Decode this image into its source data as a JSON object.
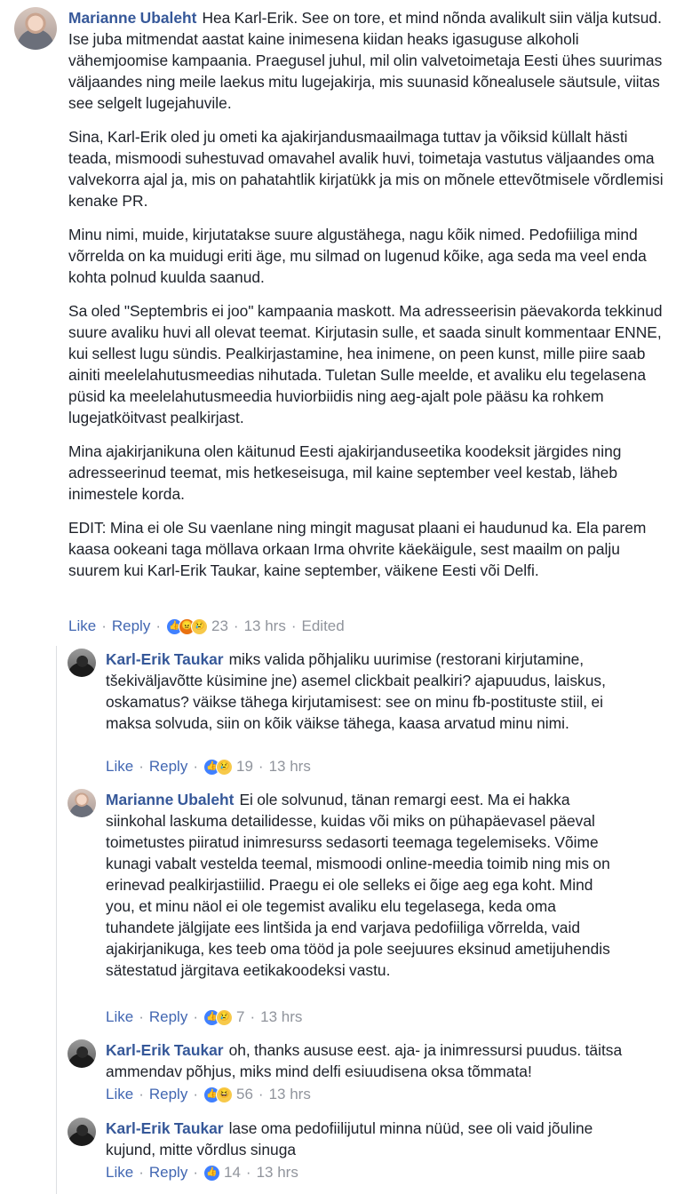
{
  "comments": [
    {
      "author": "Marianne Ubaleht",
      "paragraphs": [
        "Hea Karl-Erik. See on tore, et mind nõnda avalikult siin välja kutsud. Ise juba mitmendat aastat kaine inimesena kiidan heaks igasuguse alkoholi vähemjoomise kampaania. Praegusel juhul, mil olin valvetoimetaja Eesti ühes suurimas väljaandes ning meile laekus mitu lugejakirja, mis suunasid kõnealusele säutsule, viitas see selgelt lugejahuvile.",
        "Sina, Karl-Erik oled ju ometi ka ajakirjandusmaailmaga tuttav ja võiksid küllalt hästi teada, mismoodi suhestuvad omavahel avalik huvi, toimetaja vastutus väljaandes oma valvekorra ajal ja, mis on pahatahtlik kirjatükk ja mis on mõnele ettevõtmisele võrdlemisi kenake PR.",
        "Minu nimi, muide, kirjutatakse suure algustähega, nagu kõik nimed. Pedofiiliga mind võrrelda on ka muidugi eriti äge, mu silmad on lugenud kõike, aga seda ma veel enda kohta polnud kuulda saanud.",
        "Sa oled \"Septembris ei joo\" kampaania maskott. Ma adresseerisin päevakorda tekkinud suure avaliku huvi all olevat teemat. Kirjutasin sulle, et saada sinult kommentaar ENNE, kui sellest lugu sündis. Pealkirjastamine, hea inimene, on peen kunst, mille piire saab ainiti meelelahutusmeedias nihutada. Tuletan Sulle meelde, et avaliku elu tegelasena püsid ka meelelahutusmeedia huviorbiidis ning aeg-ajalt pole pääsu ka rohkem lugejatköitvast pealkirjast.",
        "Mina ajakirjanikuna olen käitunud Eesti ajakirjanduseetika koodeksit järgides ning adresseerinud teemat, mis hetkeseisuga, mil kaine september veel kestab, läheb inimestele korda.",
        "EDIT: Mina ei ole Su vaenlane ning mingit magusat plaani ei haudunud ka. Ela parem kaasa ookeani taga möllava orkaan Irma ohvrite käekäigule, sest maailm on palju suurem kui Karl-Erik Taukar, kaine september, väikene Eesti või Delfi."
      ],
      "like": "Like",
      "reply": "Reply",
      "reactions": [
        "like",
        "angry",
        "sad"
      ],
      "count": "23",
      "time": "13 hrs",
      "edited": "Edited"
    },
    {
      "author": "Karl-Erik Taukar",
      "text": "miks valida põhjaliku uurimise (restorani kirjutamine, tšekiväljavõtte küsimine jne) asemel clickbait pealkiri? ajapuudus, laiskus, oskamatus? väikse tähega kirjutamisest: see on minu fb-postituste stiil, ei maksa solvuda, siin on kõik väikse tähega, kaasa arvatud minu nimi.",
      "like": "Like",
      "reply": "Reply",
      "reactions": [
        "like",
        "sad"
      ],
      "count": "19",
      "time": "13 hrs"
    },
    {
      "author": "Marianne Ubaleht",
      "text": "Ei ole solvunud, tänan remargi eest. Ma ei hakka siinkohal laskuma detailidesse, kuidas või miks on pühapäevasel päeval toimetustes piiratud inimresurss sedasorti teemaga tegelemiseks. Võime kunagi vabalt vestelda teemal, mismoodi online-meedia toimib ning mis on erinevad pealkirjastiilid. Praegu ei ole selleks ei õige aeg ega koht. Mind you, et minu näol ei ole tegemist avaliku elu tegelasega, keda oma tuhandete jälgijate ees lintšida ja end varjava pedofiiliga võrrelda, vaid ajakirjanikuga, kes teeb oma tööd ja pole seejuures eksinud ametijuhendis sätestatud järgitava eetikakoodeksi vastu.",
      "like": "Like",
      "reply": "Reply",
      "reactions": [
        "like",
        "sad"
      ],
      "count": "7",
      "time": "13 hrs"
    },
    {
      "author": "Karl-Erik Taukar",
      "text": "oh, thanks aususe eest. aja- ja inimressursi puudus. täitsa ammendav põhjus, miks mind delfi esiuudisena oksa tõmmata!",
      "like": "Like",
      "reply": "Reply",
      "reactions": [
        "like",
        "haha"
      ],
      "count": "56",
      "time": "13 hrs"
    },
    {
      "author": "Karl-Erik Taukar",
      "text": "lase oma pedofiilijutul minna nüüd, see oli vaid jõuline kujund, mitte võrdlus sinuga",
      "like": "Like",
      "reply": "Reply",
      "reactions": [
        "like"
      ],
      "count": "14",
      "time": "13 hrs"
    }
  ],
  "colors": {
    "link": "#4267b2",
    "author": "#365899",
    "meta": "#90949c",
    "text": "#1d2129"
  }
}
